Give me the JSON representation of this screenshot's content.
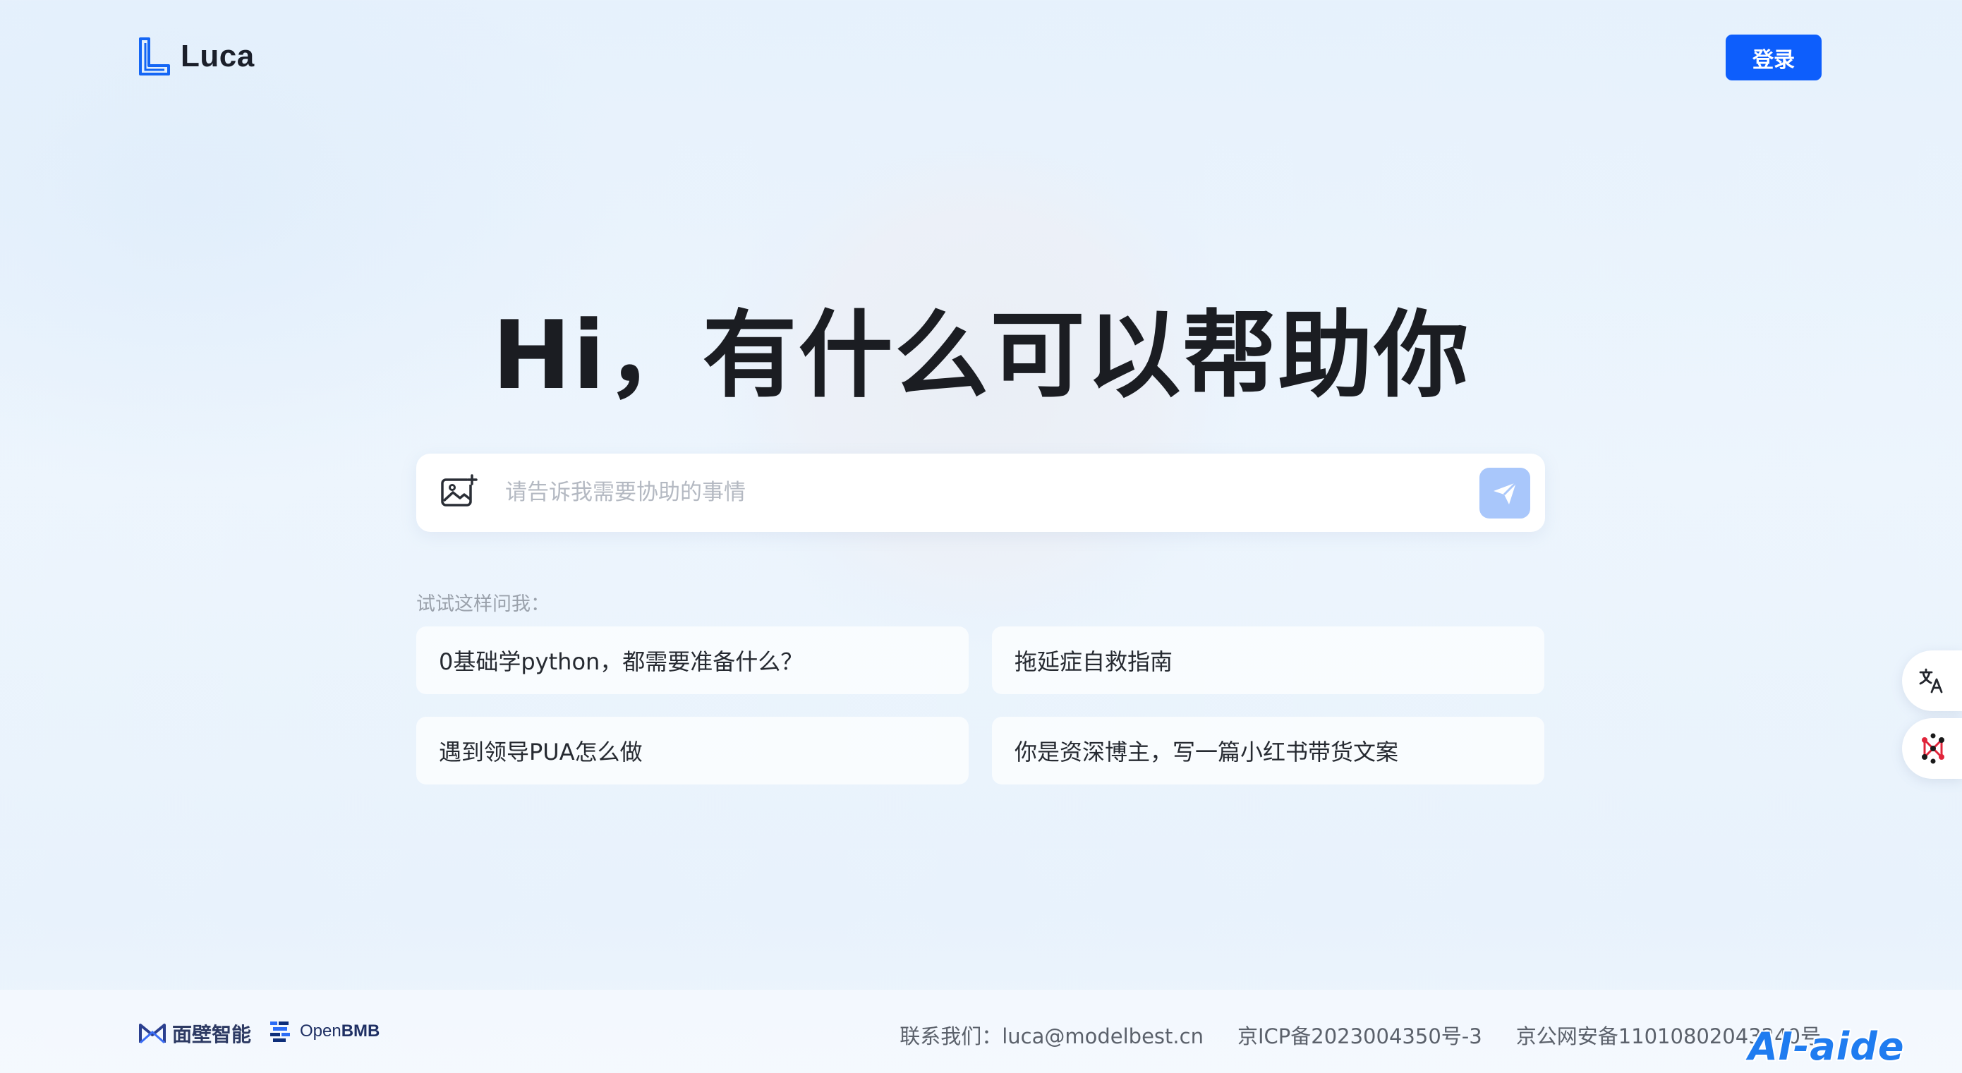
{
  "header": {
    "brand": "Luca",
    "login_label": "登录"
  },
  "hero": {
    "title": "Hi，有什么可以帮助你"
  },
  "search": {
    "placeholder": "请告诉我需要协助的事情"
  },
  "suggestions": {
    "label": "试试这样问我：",
    "items": [
      "0基础学python，都需要准备什么？",
      "拖延症自救指南",
      "遇到领导PUA怎么做",
      "你是资深博主，写一篇小红书带货文案"
    ]
  },
  "footer": {
    "partner1": "面壁智能",
    "partner2_prefix": "Open",
    "partner2_suffix": "BMB",
    "contact": "联系我们：luca@modelbest.cn",
    "icp": "京ICP备2023004350号-3",
    "police": "京公网安备11010802043240号"
  },
  "watermark": "AI-aide",
  "colors": {
    "primary": "#0d5efc",
    "send_disabled": "#a9c7fb"
  },
  "icons": [
    "luca-logo-icon",
    "image-upload-icon",
    "send-icon",
    "translate-icon",
    "network-icon",
    "modelbest-logo-icon",
    "openbmb-logo-icon"
  ]
}
